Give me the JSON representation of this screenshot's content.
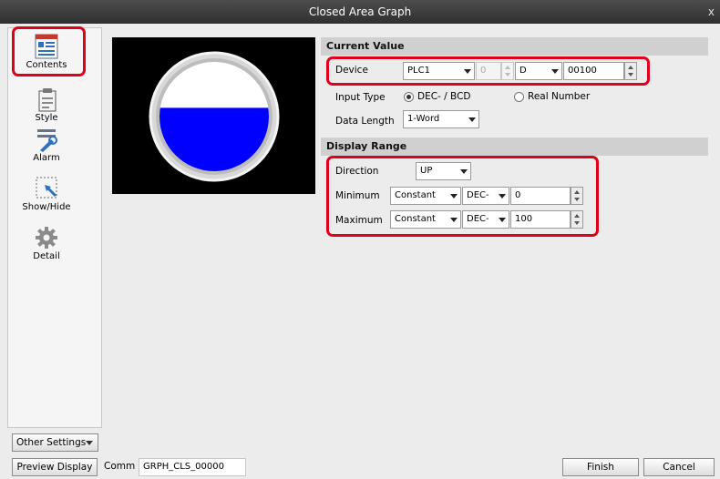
{
  "window": {
    "title": "Closed Area Graph",
    "close": "x"
  },
  "sidebar": {
    "items": [
      {
        "label": "Contents",
        "icon": "contents-icon"
      },
      {
        "label": "Style",
        "icon": "style-icon"
      },
      {
        "label": "Alarm",
        "icon": "alarm-icon"
      },
      {
        "label": "Show/Hide",
        "icon": "show-hide-icon"
      },
      {
        "label": "Detail",
        "icon": "gear-icon"
      }
    ],
    "other_settings": "Other Settings"
  },
  "preview": {
    "fill_level": 0.58,
    "fill_color": "#0000ff"
  },
  "current_value": {
    "header": "Current Value",
    "device_label": "Device",
    "plc": "PLC1",
    "station": "0",
    "device_type": "D",
    "address": "00100",
    "input_type_label": "Input Type",
    "input_option_1": "DEC- / BCD",
    "input_option_2": "Real Number",
    "data_length_label": "Data Length",
    "data_length": "1-Word"
  },
  "display_range": {
    "header": "Display Range",
    "direction_label": "Direction",
    "direction": "UP",
    "minimum_label": "Minimum",
    "min_source": "Constant",
    "min_format": "DEC-",
    "min_value": "0",
    "maximum_label": "Maximum",
    "max_source": "Constant",
    "max_format": "DEC-",
    "max_value": "100"
  },
  "bottom": {
    "preview_display": "Preview Display",
    "comm_label": "Comm",
    "comm_value": "GRPH_CLS_00000",
    "finish": "Finish",
    "cancel": "Cancel"
  },
  "colors": {
    "highlight": "#e0001b",
    "section_header": "#d0d0d0",
    "title_bar": "#3a3a3a"
  }
}
